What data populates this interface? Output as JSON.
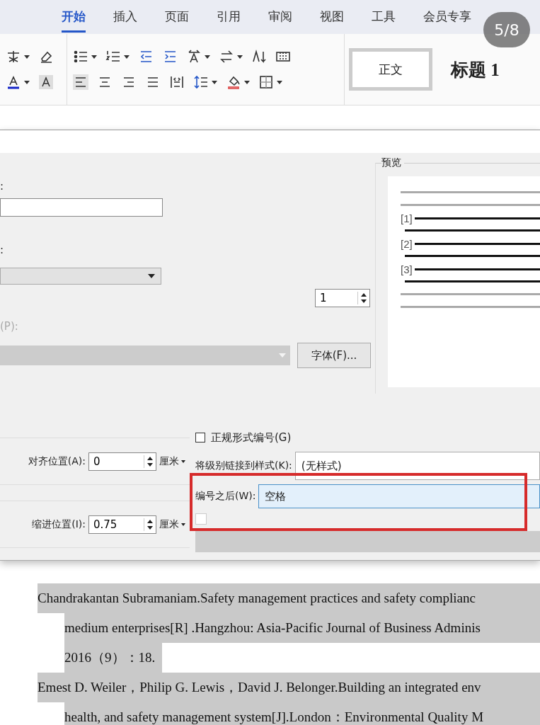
{
  "tabs": [
    {
      "label": "开始",
      "selected": true
    },
    {
      "label": "插入",
      "selected": false
    },
    {
      "label": "页面",
      "selected": false
    },
    {
      "label": "引用",
      "selected": false
    },
    {
      "label": "审阅",
      "selected": false
    },
    {
      "label": "视图",
      "selected": false
    },
    {
      "label": "工具",
      "selected": false
    },
    {
      "label": "会员专享",
      "selected": false
    }
  ],
  "page_counter": "5/8",
  "ribbon": {
    "styles": [
      {
        "label": "正文",
        "selected": true
      },
      {
        "label": "标题 1",
        "selected": false
      }
    ]
  },
  "dialog": {
    "colon_labels": [
      ":",
      ":"
    ],
    "start_at": {
      "value": "1"
    },
    "number_font_label": "(P):",
    "font_button": "字体(F)...",
    "preview": {
      "title": "预览",
      "items": [
        "[1]",
        "[2]",
        "[3]"
      ]
    },
    "aligned_at": {
      "label": "对齐位置(A):",
      "value": "0",
      "unit": "厘米"
    },
    "indent_at": {
      "label": "缩进位置(I):",
      "value": "0.75",
      "unit": "厘米"
    },
    "legal_numbering": {
      "label": "正规形式编号(G)",
      "checked": false
    },
    "link_style": {
      "label": "将级别链接到样式(K):",
      "value": "(无样式)"
    },
    "follow_number": {
      "label": "编号之后(W):",
      "value": "空格",
      "highlighted": true
    },
    "restart_numbering": {
      "checked": false,
      "disabled": true
    }
  },
  "document": {
    "paragraphs": [
      {
        "lines": [
          "Chandrakantan Subramaniam.Safety management practices and safety complianc",
          "medium enterprises[R] .Hangzhou: Asia-Pacific Journal of Business Adminis",
          "2016（9）：18."
        ]
      },
      {
        "lines": [
          "Emest D. Weiler，Philip G. Lewis，David J. Belonger.Building an integrated env",
          "health, and safety management system[J].London：Environmental Quality M"
        ]
      }
    ]
  }
}
